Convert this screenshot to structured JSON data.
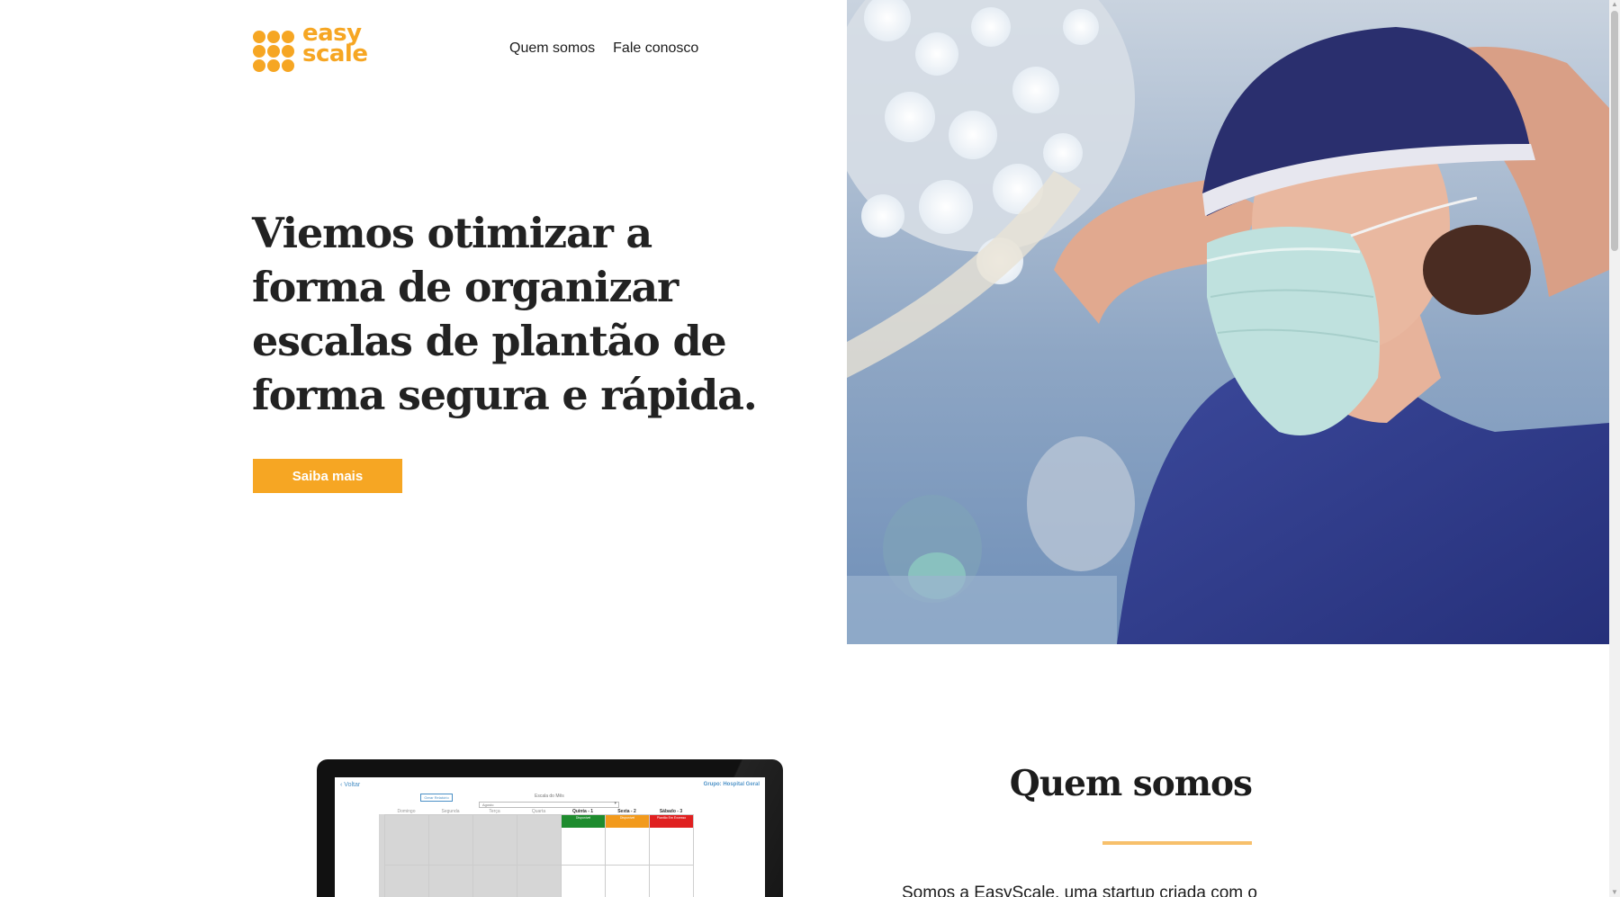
{
  "brand": {
    "logo_line1": "easy",
    "logo_line2": "scale",
    "accent_color": "#f6a623"
  },
  "nav": {
    "items": [
      {
        "label": "Quem somos"
      },
      {
        "label": "Fale conosco"
      }
    ]
  },
  "hero": {
    "title": "Viemos otimizar a forma de organizar escalas de plantão de forma segura e rápida.",
    "cta_label": "Saiba mais",
    "image_icon": "surgeon-photo"
  },
  "app_preview": {
    "back_label": "Voltar",
    "group_label": "Grupo: Hospital Geral",
    "report_button": "Gerar Relatório",
    "month_label": "Escala do Mês",
    "month_value": "Agosto",
    "days": [
      "Domingo",
      "Segunda",
      "Terça",
      "Quarta",
      "Quinta - 1",
      "Sexta - 2",
      "Sábado - 3"
    ],
    "shift_chips": [
      {
        "text": "Disponível",
        "color": "#1e8c2e"
      },
      {
        "text": "Disponível",
        "color": "#f29a1c"
      },
      {
        "text": "Plantão Em Excesso",
        "color": "#e02020"
      }
    ]
  },
  "about": {
    "title": "Quem somos",
    "intro": "Somos a EasyScale, uma startup criada com o"
  }
}
